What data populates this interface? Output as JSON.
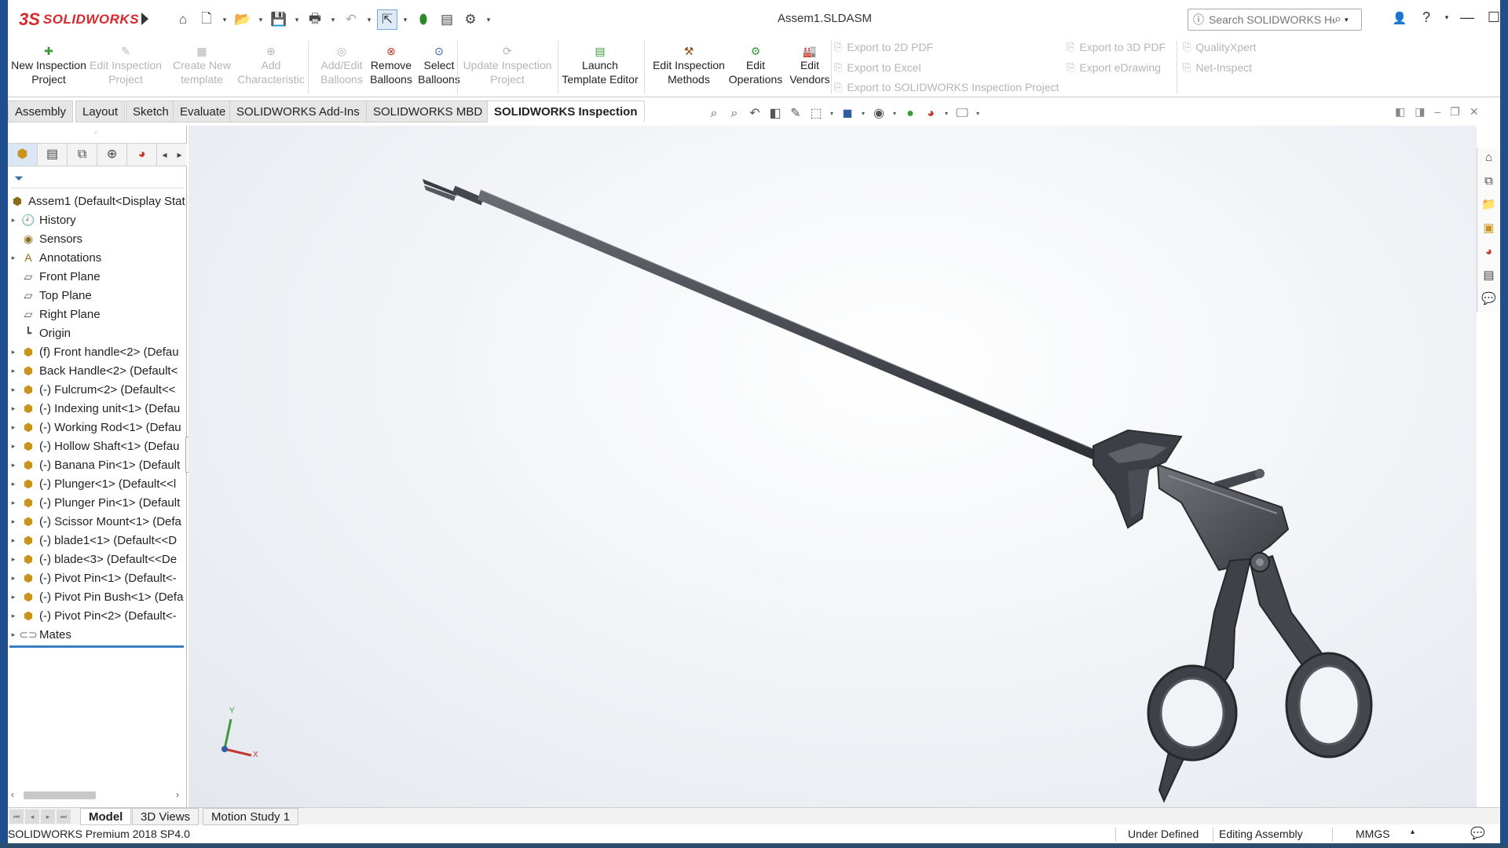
{
  "app": {
    "logo_ds": "3S",
    "logo_text": "SOLIDWORKS",
    "document_title": "Assem1.SLDASM",
    "help_search_placeholder": "Search SOLIDWORKS Help"
  },
  "quick_toolbar": [
    "home-icon",
    "new-document-icon",
    "open-icon",
    "save-icon",
    "print-icon",
    "undo-icon",
    "select-icon",
    "rebuild-icon",
    "file-properties-icon",
    "options-icon"
  ],
  "ribbon": {
    "new_inspection_project": "New Inspection Project",
    "edit_inspection_project": "Edit Inspection Project",
    "create_new_template": "Create New template",
    "add_characteristic": "Add Characteristic",
    "add_edit_balloons": "Add/Edit Balloons",
    "remove_balloons": "Remove Balloons",
    "select_balloons": "Select Balloons",
    "update_inspection_project": "Update Inspection Project",
    "launch_template_editor": "Launch Template Editor",
    "edit_inspection_methods": "Edit Inspection Methods",
    "edit_operations": "Edit Operations",
    "edit_vendors": "Edit Vendors",
    "export_2d_pdf": "Export to 2D PDF",
    "export_excel": "Export to Excel",
    "export_sw_inspection": "Export to SOLIDWORKS Inspection Project",
    "export_3d_pdf": "Export to 3D PDF",
    "export_edrawing": "Export eDrawing",
    "qualityxpert": "QualityXpert",
    "net_inspect": "Net-Inspect"
  },
  "tabs": {
    "assembly": "Assembly",
    "layout": "Layout",
    "sketch": "Sketch",
    "evaluate": "Evaluate",
    "addins": "SOLIDWORKS Add-Ins",
    "mbd": "SOLIDWORKS MBD",
    "inspection": "SOLIDWORKS Inspection"
  },
  "feature_tree": {
    "root": "Assem1  (Default<Display Stat",
    "items": [
      {
        "label": "History",
        "icon": "history-icon"
      },
      {
        "label": "Sensors",
        "icon": "sensors-icon"
      },
      {
        "label": "Annotations",
        "icon": "annotations-icon"
      },
      {
        "label": "Front Plane",
        "icon": "plane-icon"
      },
      {
        "label": "Top Plane",
        "icon": "plane-icon"
      },
      {
        "label": "Right Plane",
        "icon": "plane-icon"
      },
      {
        "label": "Origin",
        "icon": "origin-icon"
      },
      {
        "label": "(f) Front handle<2> (Defau",
        "icon": "part-icon"
      },
      {
        "label": "Back Handle<2> (Default<",
        "icon": "part-icon"
      },
      {
        "label": "(-) Fulcrum<2> (Default<<",
        "icon": "part-icon"
      },
      {
        "label": "(-) Indexing unit<1> (Defau",
        "icon": "subassembly-icon"
      },
      {
        "label": "(-) Working Rod<1> (Defau",
        "icon": "part-icon"
      },
      {
        "label": "(-) Hollow Shaft<1> (Defau",
        "icon": "part-icon"
      },
      {
        "label": "(-) Banana Pin<1> (Default",
        "icon": "part-icon"
      },
      {
        "label": "(-) Plunger<1> (Default<<l",
        "icon": "part-icon"
      },
      {
        "label": "(-) Plunger Pin<1> (Default",
        "icon": "part-icon"
      },
      {
        "label": "(-) Scissor Mount<1> (Defa",
        "icon": "part-icon"
      },
      {
        "label": "(-) blade1<1> (Default<<D",
        "icon": "part-icon"
      },
      {
        "label": "(-) blade<3> (Default<<De",
        "icon": "part-icon"
      },
      {
        "label": "(-) Pivot Pin<1> (Default<-",
        "icon": "part-icon"
      },
      {
        "label": "(-) Pivot Pin Bush<1> (Defa",
        "icon": "part-icon"
      },
      {
        "label": "(-) Pivot Pin<2> (Default<-",
        "icon": "part-icon"
      },
      {
        "label": "Mates",
        "icon": "mates-icon"
      }
    ]
  },
  "triad": {
    "x_label": "X",
    "y_label": "Y"
  },
  "bottom_tabs": {
    "model": "Model",
    "views_3d": "3D Views",
    "motion_study": "Motion Study 1"
  },
  "status": {
    "product": "SOLIDWORKS Premium 2018 SP4.0",
    "definition": "Under Defined",
    "mode": "Editing Assembly",
    "units": "MMGS"
  },
  "colors": {
    "brand_red": "#d8282c",
    "selection_blue": "#3c7fc6",
    "model_gray": "#4a4d54"
  }
}
